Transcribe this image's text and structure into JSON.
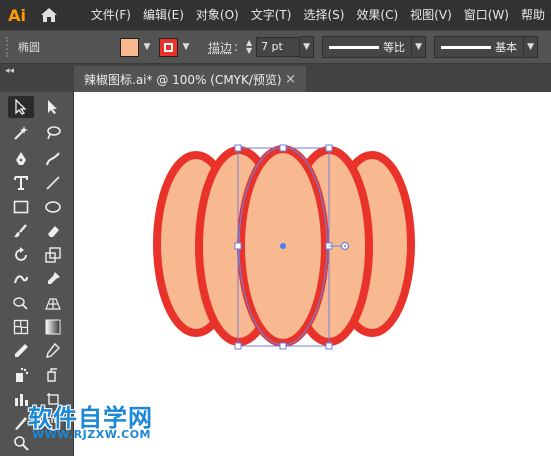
{
  "app": {
    "logo": "Ai"
  },
  "menu": {
    "items": [
      "文件(F)",
      "编辑(E)",
      "对象(O)",
      "文字(T)",
      "选择(S)",
      "效果(C)",
      "视图(V)",
      "窗口(W)",
      "帮助"
    ]
  },
  "control": {
    "tool_name": "椭圆",
    "fill_color": "#f8b990",
    "stroke_color": "#e8322a",
    "stroke_label": "描边",
    "stroke_weight": "7 pt",
    "profile_label": "等比",
    "brush_label": "基本"
  },
  "document": {
    "tab_title": "辣椒图标.ai* @ 100% (CMYK/预览)",
    "close_glyph": "×"
  },
  "artwork": {
    "fill_color": "#f8b990",
    "stroke_color": "#e8322a",
    "selection_color": "#6f7fdc",
    "description_shapes": 5
  },
  "watermark": {
    "title": "软件自学网",
    "url": "WWW.RJZXW.COM",
    "color": "#1a88d6"
  },
  "icons": {
    "home": "home-icon",
    "selection": "selection-tool-icon",
    "direct_selection": "direct-selection-tool-icon"
  }
}
